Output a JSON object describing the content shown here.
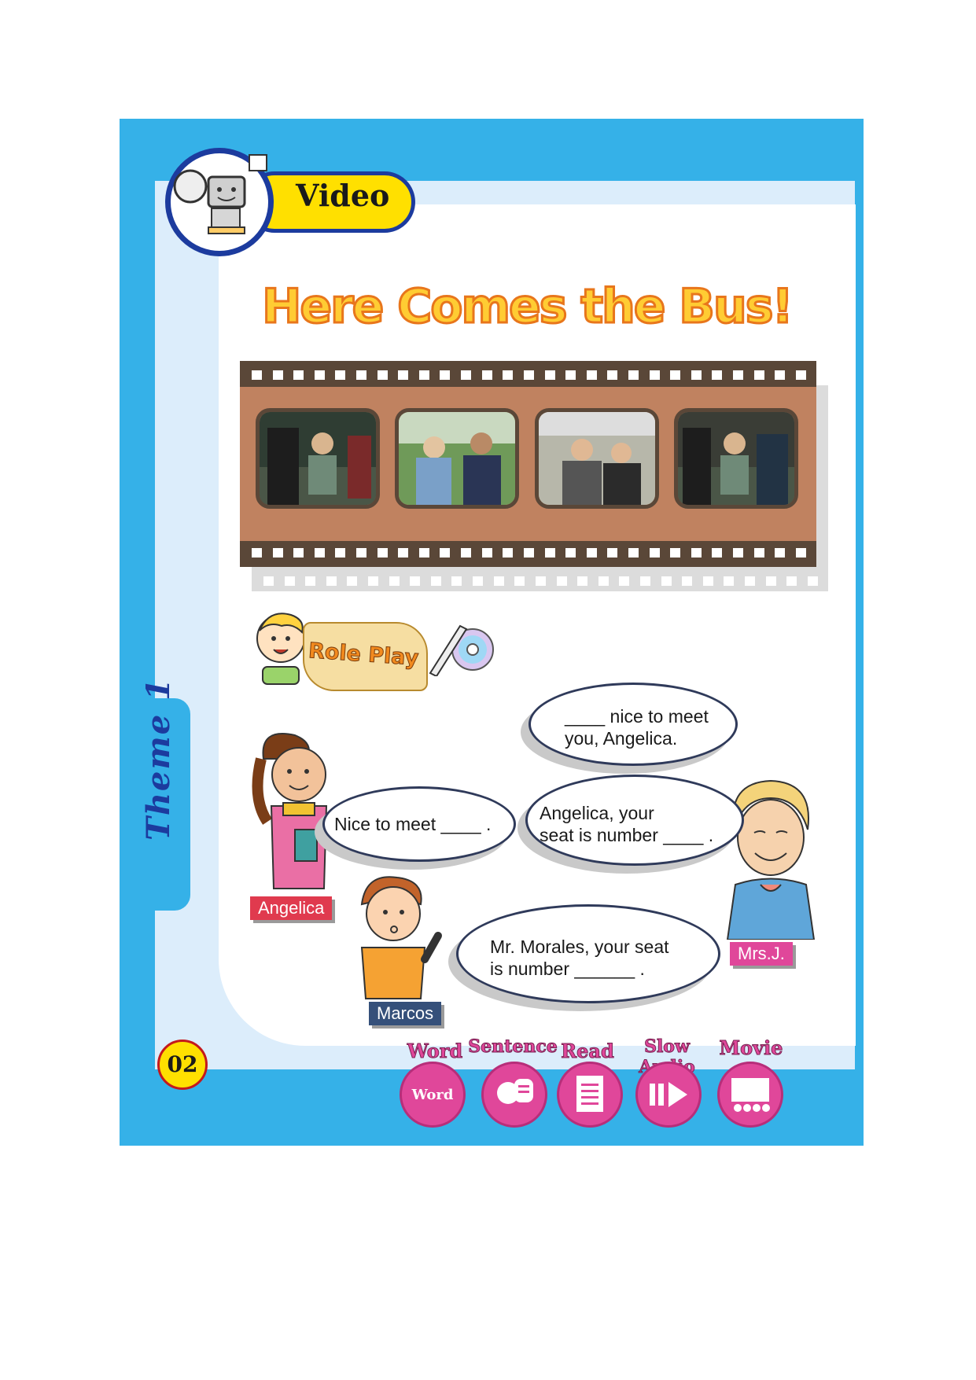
{
  "header": {
    "badge": "Video"
  },
  "title": "Here Comes the Bus!",
  "sidebar": {
    "theme": "Theme 1"
  },
  "film": {
    "frames": [
      {
        "name": "frame-1"
      },
      {
        "name": "frame-2"
      },
      {
        "name": "frame-3"
      },
      {
        "name": "frame-4"
      }
    ]
  },
  "roleplay": {
    "label": "Role Play"
  },
  "bubbles": {
    "top": [
      "____ nice to meet",
      "you, Angelica."
    ],
    "left": "Nice to meet ____ .",
    "middle": [
      "Angelica, your",
      "seat is number ____ ."
    ],
    "bottom": [
      "Mr. Morales, your seat",
      "is number ______ ."
    ]
  },
  "names": {
    "angelica": "Angelica",
    "marcos": "Marcos",
    "mrsj": "Mrs.J."
  },
  "footer": {
    "page": "02",
    "buttons": [
      {
        "label": "Word",
        "icon": "word-icon"
      },
      {
        "label": "Sentence",
        "icon": "speech-icon"
      },
      {
        "label": "Read",
        "icon": "document-icon"
      },
      {
        "label": "Slow Audio",
        "icon": "slow-play-icon"
      },
      {
        "label": "Movie",
        "icon": "theater-icon"
      }
    ]
  },
  "colors": {
    "frame": "#35b1e8",
    "accent": "#ffe000",
    "navy": "#1c3b9e",
    "pink": "#e0479a"
  }
}
